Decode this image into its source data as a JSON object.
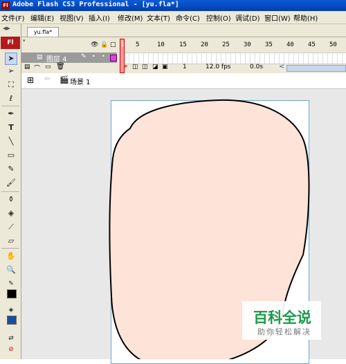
{
  "window": {
    "title": "Adobe Flash CS3 Professional - [yu.fla*]",
    "logo_text": "Fl"
  },
  "menu": [
    "文件(F)",
    "编辑(E)",
    "视图(V)",
    "插入(I)",
    "修改(M)",
    "文本(T)",
    "命令(C)",
    "控制(O)",
    "调试(D)",
    "窗口(W)",
    "帮助(H)"
  ],
  "toolbox": {
    "logo": "Fl",
    "tools": [
      "selection-tool",
      "subselection-tool",
      "free-transform-tool",
      "lasso-tool",
      "pen-tool",
      "text-tool",
      "line-tool",
      "rectangle-tool",
      "pencil-tool",
      "brush-tool",
      "ink-bottle-tool",
      "paint-bucket-tool",
      "eyedropper-tool",
      "eraser-tool",
      "hand-tool",
      "zoom-tool"
    ],
    "stroke_color": "#000000",
    "fill_color": "#1a4fa0"
  },
  "document_tab": "yu.fla*",
  "timeline": {
    "frame_numbers": [
      "1",
      "5",
      "10",
      "15",
      "20",
      "25",
      "30",
      "35",
      "40",
      "45",
      "50"
    ],
    "layer_name": "图层 4",
    "current_frame": "1",
    "frame_rate": "12.0 fps",
    "elapsed_time": "0.0s"
  },
  "edit_bar": {
    "scene": "场景 1"
  },
  "stage": {
    "shape_fill": "#fde3d8",
    "shape_stroke": "#000000"
  },
  "watermark": {
    "title": "百科全说",
    "subtitle": "助你轻松解决"
  }
}
